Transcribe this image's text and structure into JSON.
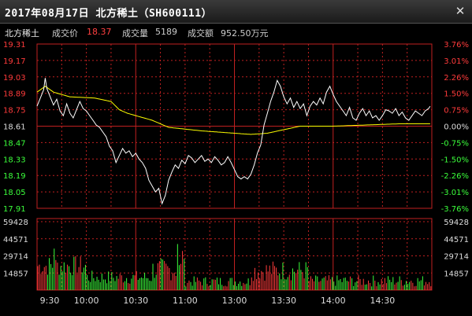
{
  "window": {
    "title": "2017年08月17日 北方稀土（SH600111）",
    "close_icon": "close-icon"
  },
  "info": {
    "stock_name": "北方稀土",
    "price_label": "成交价",
    "price_value": "18.37",
    "volume_label": "成交量",
    "volume_value": "5189",
    "amount_label": "成交额",
    "amount_value": "952.50万元"
  },
  "colors": {
    "up": "#ff3b3b",
    "down": "#3bff3b",
    "frame": "#c02020",
    "price_line": "#ffffff",
    "avg_line": "#ffff00",
    "neutral": "#dddddd"
  },
  "chart_data": {
    "type": "line",
    "prev_close": 18.61,
    "price_ylim": [
      17.91,
      19.31
    ],
    "price_ticks": [
      "19.31",
      "19.17",
      "19.03",
      "18.89",
      "18.75",
      "18.61",
      "18.47",
      "18.33",
      "18.19",
      "18.05",
      "17.91"
    ],
    "pct_ticks": [
      "3.76%",
      "3.01%",
      "2.26%",
      "1.50%",
      "0.75%",
      "0.00%",
      "-0.75%",
      "-1.50%",
      "-2.26%",
      "-3.01%",
      "-3.76%"
    ],
    "volume_ylim": [
      0,
      59428
    ],
    "volume_ticks": [
      "59428",
      "44571",
      "29714",
      "14857"
    ],
    "x_ticks": [
      "9:30",
      "10:00",
      "10:30",
      "11:00",
      "13:00",
      "13:30",
      "14:00",
      "14:30"
    ],
    "minutes_total": 240,
    "price_anchors": [
      [
        0,
        18.78
      ],
      [
        2,
        18.85
      ],
      [
        4,
        18.92
      ],
      [
        5,
        19.02
      ],
      [
        6,
        18.93
      ],
      [
        8,
        18.86
      ],
      [
        10,
        18.79
      ],
      [
        12,
        18.84
      ],
      [
        14,
        18.74
      ],
      [
        16,
        18.7
      ],
      [
        18,
        18.8
      ],
      [
        20,
        18.72
      ],
      [
        22,
        18.68
      ],
      [
        24,
        18.75
      ],
      [
        26,
        18.82
      ],
      [
        28,
        18.76
      ],
      [
        30,
        18.74
      ],
      [
        32,
        18.7
      ],
      [
        34,
        18.66
      ],
      [
        36,
        18.62
      ],
      [
        38,
        18.6
      ],
      [
        40,
        18.56
      ],
      [
        42,
        18.52
      ],
      [
        44,
        18.44
      ],
      [
        46,
        18.4
      ],
      [
        48,
        18.3
      ],
      [
        50,
        18.36
      ],
      [
        52,
        18.42
      ],
      [
        54,
        18.38
      ],
      [
        56,
        18.4
      ],
      [
        58,
        18.35
      ],
      [
        60,
        18.38
      ],
      [
        62,
        18.33
      ],
      [
        64,
        18.3
      ],
      [
        66,
        18.25
      ],
      [
        68,
        18.15
      ],
      [
        70,
        18.1
      ],
      [
        72,
        18.05
      ],
      [
        74,
        18.08
      ],
      [
        76,
        17.95
      ],
      [
        78,
        18.02
      ],
      [
        80,
        18.15
      ],
      [
        82,
        18.22
      ],
      [
        84,
        18.28
      ],
      [
        86,
        18.25
      ],
      [
        88,
        18.32
      ],
      [
        90,
        18.29
      ],
      [
        92,
        18.36
      ],
      [
        94,
        18.34
      ],
      [
        96,
        18.3
      ],
      [
        98,
        18.33
      ],
      [
        100,
        18.36
      ],
      [
        102,
        18.31
      ],
      [
        104,
        18.33
      ],
      [
        106,
        18.3
      ],
      [
        108,
        18.35
      ],
      [
        110,
        18.32
      ],
      [
        112,
        18.28
      ],
      [
        114,
        18.3
      ],
      [
        116,
        18.35
      ],
      [
        118,
        18.3
      ],
      [
        120,
        18.24
      ],
      [
        122,
        18.18
      ],
      [
        124,
        18.16
      ],
      [
        126,
        18.18
      ],
      [
        128,
        18.16
      ],
      [
        130,
        18.2
      ],
      [
        132,
        18.28
      ],
      [
        134,
        18.38
      ],
      [
        136,
        18.45
      ],
      [
        138,
        18.62
      ],
      [
        140,
        18.72
      ],
      [
        142,
        18.82
      ],
      [
        144,
        18.9
      ],
      [
        146,
        19.0
      ],
      [
        148,
        18.95
      ],
      [
        150,
        18.86
      ],
      [
        152,
        18.8
      ],
      [
        154,
        18.85
      ],
      [
        156,
        18.77
      ],
      [
        158,
        18.82
      ],
      [
        160,
        18.76
      ],
      [
        162,
        18.8
      ],
      [
        164,
        18.7
      ],
      [
        166,
        18.78
      ],
      [
        168,
        18.82
      ],
      [
        170,
        18.79
      ],
      [
        172,
        18.85
      ],
      [
        174,
        18.8
      ],
      [
        176,
        18.9
      ],
      [
        178,
        18.95
      ],
      [
        180,
        18.88
      ],
      [
        182,
        18.82
      ],
      [
        184,
        18.78
      ],
      [
        186,
        18.74
      ],
      [
        188,
        18.7
      ],
      [
        190,
        18.77
      ],
      [
        192,
        18.68
      ],
      [
        194,
        18.66
      ],
      [
        196,
        18.72
      ],
      [
        198,
        18.76
      ],
      [
        200,
        18.7
      ],
      [
        202,
        18.74
      ],
      [
        204,
        18.68
      ],
      [
        206,
        18.7
      ],
      [
        208,
        18.66
      ],
      [
        210,
        18.7
      ],
      [
        212,
        18.75
      ],
      [
        214,
        18.74
      ],
      [
        216,
        18.72
      ],
      [
        218,
        18.76
      ],
      [
        220,
        18.7
      ],
      [
        222,
        18.73
      ],
      [
        224,
        18.68
      ],
      [
        226,
        18.66
      ],
      [
        228,
        18.7
      ],
      [
        230,
        18.74
      ],
      [
        232,
        18.72
      ],
      [
        234,
        18.7
      ],
      [
        236,
        18.74
      ],
      [
        238,
        18.76
      ],
      [
        239,
        18.78
      ]
    ],
    "avg_anchors": [
      [
        0,
        18.9
      ],
      [
        5,
        18.95
      ],
      [
        10,
        18.9
      ],
      [
        20,
        18.86
      ],
      [
        35,
        18.85
      ],
      [
        45,
        18.82
      ],
      [
        50,
        18.75
      ],
      [
        55,
        18.72
      ],
      [
        60,
        18.7
      ],
      [
        70,
        18.66
      ],
      [
        80,
        18.6
      ],
      [
        100,
        18.57
      ],
      [
        120,
        18.55
      ],
      [
        130,
        18.54
      ],
      [
        140,
        18.55
      ],
      [
        150,
        18.58
      ],
      [
        160,
        18.61
      ],
      [
        180,
        18.61
      ],
      [
        200,
        18.62
      ],
      [
        220,
        18.63
      ],
      [
        239,
        18.63
      ]
    ]
  }
}
